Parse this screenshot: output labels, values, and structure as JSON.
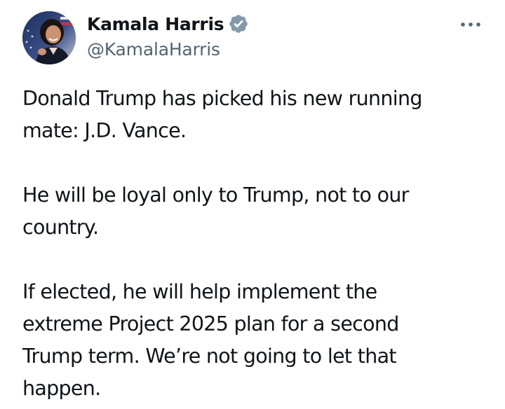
{
  "post": {
    "author": {
      "name": "Kamala Harris",
      "handle": "@KamalaHarris",
      "verified": true,
      "avatar_icon": "profile-photo"
    },
    "more_icon": "more-options-icon",
    "paragraphs": [
      [
        "Donald Trump has picked his new running",
        "mate: J.D. Vance."
      ],
      [
        "He will be loyal only to Trump, not to our",
        "country."
      ],
      [
        "If elected, he will help implement the",
        "extreme Project 2025 plan for a second",
        "Trump term. We’re not going to let that",
        "happen."
      ]
    ]
  },
  "colors": {
    "text": "#0f1419",
    "secondary": "#536471",
    "verified_badge": "#829aab",
    "background": "#ffffff"
  }
}
